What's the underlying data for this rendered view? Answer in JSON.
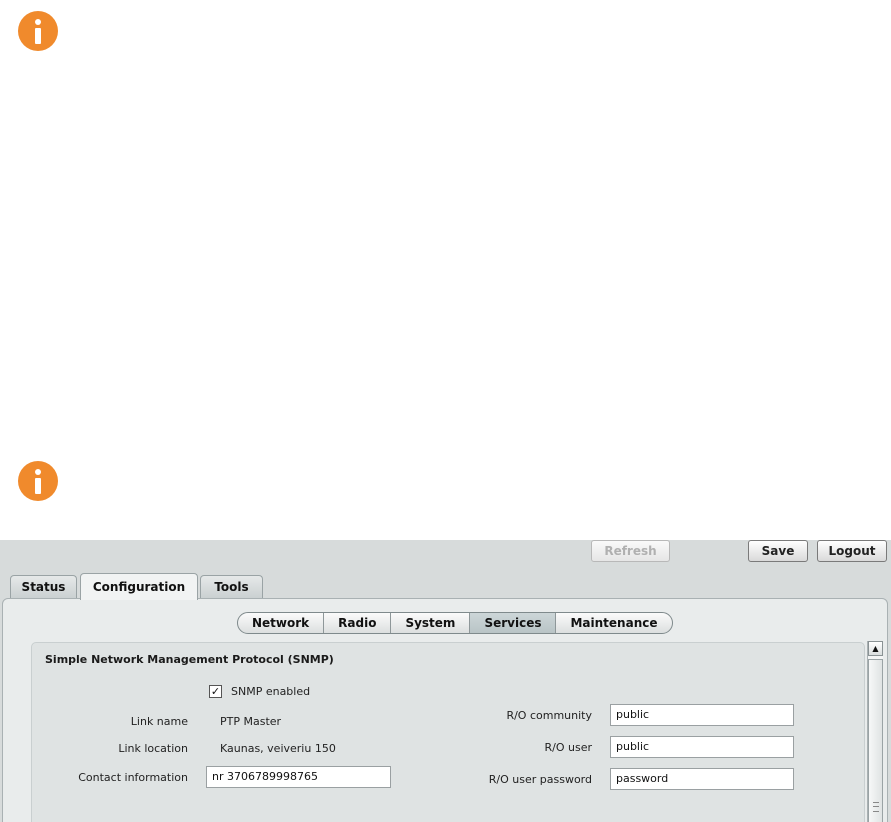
{
  "icons": {
    "info": "info-icon"
  },
  "colors": {
    "info_accent": "#f08a2c",
    "active_subtab": "#c2ccce"
  },
  "toolbar": {
    "refresh_label": "Refresh",
    "save_label": "Save",
    "logout_label": "Logout"
  },
  "tabs": [
    {
      "label": "Status"
    },
    {
      "label": "Configuration"
    },
    {
      "label": "Tools"
    }
  ],
  "subnav": [
    {
      "label": "Network"
    },
    {
      "label": "Radio"
    },
    {
      "label": "System"
    },
    {
      "label": "Services"
    },
    {
      "label": "Maintenance"
    }
  ],
  "snmp": {
    "title": "Simple Network Management Protocol (SNMP)",
    "enabled_label": "SNMP enabled",
    "enabled_checked": true,
    "link_name_label": "Link name",
    "link_name_value": "PTP Master",
    "link_location_label": "Link location",
    "link_location_value": "Kaunas, veiveriu 150",
    "contact_label": "Contact information",
    "contact_value": "nr 3706789998765",
    "ro_community_label": "R/O community",
    "ro_community_value": "public",
    "ro_user_label": "R/O user",
    "ro_user_value": "public",
    "ro_password_label": "R/O user password",
    "ro_password_value": "password"
  }
}
